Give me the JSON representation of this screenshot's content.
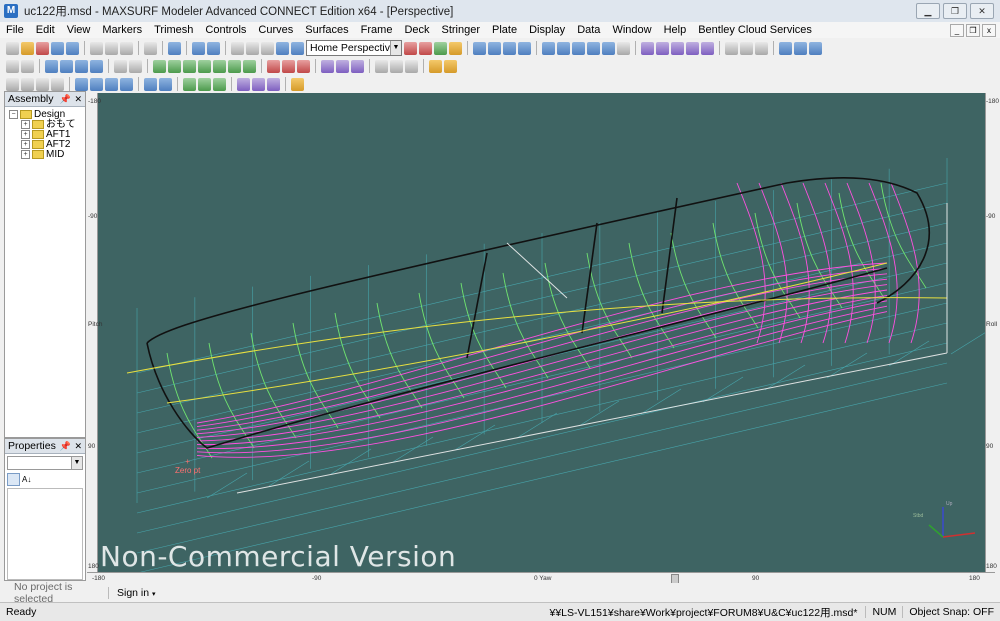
{
  "window": {
    "title": "uc122用.msd - MAXSURF Modeler Advanced CONNECT Edition x64 - [Perspective]",
    "app_icon": "maxsurf-app-icon",
    "minimize": "minimize-icon",
    "restore": "restore-icon",
    "close": "close-icon"
  },
  "menu": [
    "File",
    "Edit",
    "View",
    "Markers",
    "Trimesh",
    "Controls",
    "Curves",
    "Surfaces",
    "Frame",
    "Deck",
    "Stringer",
    "Plate",
    "Display",
    "Data",
    "Window",
    "Help",
    "Bentley Cloud Services"
  ],
  "view_select": {
    "value": "Home Perspective"
  },
  "assembly_panel": {
    "title": "Assembly",
    "tree": [
      {
        "label": "Design",
        "expand": "−"
      },
      {
        "label": "おもて",
        "expand": "+"
      },
      {
        "label": "AFT1",
        "expand": "+"
      },
      {
        "label": "AFT2",
        "expand": "+"
      },
      {
        "label": "MID",
        "expand": "+"
      }
    ]
  },
  "properties_panel": {
    "title": "Properties",
    "sort_label": "A↓"
  },
  "viewport": {
    "watermark": "Non-Commercial Version",
    "origin_label": "Zero pt",
    "axes": {
      "x_label": "Yaw",
      "y_label": "Roll",
      "triad_z": "Up",
      "triad_y": "Stbd"
    },
    "ruler_left": [
      "-180",
      "-90",
      "0",
      "90",
      "180"
    ],
    "ruler_bottom": [
      "-180",
      "-90",
      "0",
      "90",
      "180"
    ],
    "ruler_left_axis": "Pitch",
    "ruler_right_axis": "Roll",
    "ruler_bottom_mid": "0 Yaw"
  },
  "bottom": {
    "no_project": "No project is selected",
    "sign_in": "Sign in"
  },
  "status": {
    "ready": "Ready",
    "path": "¥¥LS-VL151¥share¥Work¥project¥FORUM8¥U&C¥uc122用.msd*",
    "num": "NUM",
    "snap": "Object Snap: OFF"
  },
  "colors": {
    "viewport_bg": "#3e6463",
    "grid": "#49b0b8",
    "magenta": "#ff50e0",
    "green": "#6fe36f",
    "yellow": "#e8e040"
  }
}
